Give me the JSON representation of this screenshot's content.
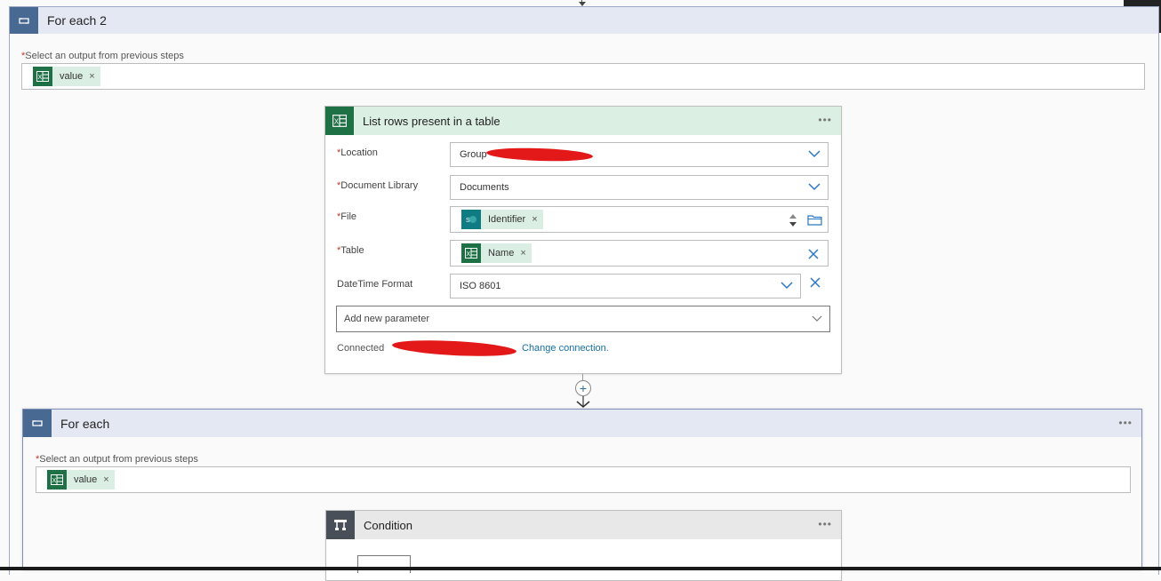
{
  "outer_loop": {
    "title": "For each 2",
    "select_label": "Select an output from previous steps",
    "token": "value"
  },
  "action": {
    "title": "List rows present in a table",
    "fields": {
      "location_label": "Location",
      "location_value": "Group",
      "library_label": "Document Library",
      "library_value": "Documents",
      "file_label": "File",
      "file_token": "Identifier",
      "table_label": "Table",
      "table_token": "Name",
      "datetime_label": "DateTime Format",
      "datetime_value": "ISO 8601"
    },
    "add_param": "Add new parameter",
    "connected_label": "Connected",
    "change_connection": "Change connection."
  },
  "inner_loop": {
    "title": "For each",
    "select_label": "Select an output from previous steps",
    "token": "value"
  },
  "condition": {
    "title": "Condition"
  },
  "colors": {
    "excel": "#1e7145",
    "sharepoint": "#0f7b83",
    "loop_header": "#486991",
    "condition_header": "#484f58",
    "link": "#1570a6"
  },
  "icons": [
    "loop-icon",
    "excel-icon",
    "sharepoint-icon",
    "chevron-down-icon",
    "close-icon",
    "folder-icon",
    "zoom-icon",
    "condition-icon",
    "plus-icon"
  ]
}
